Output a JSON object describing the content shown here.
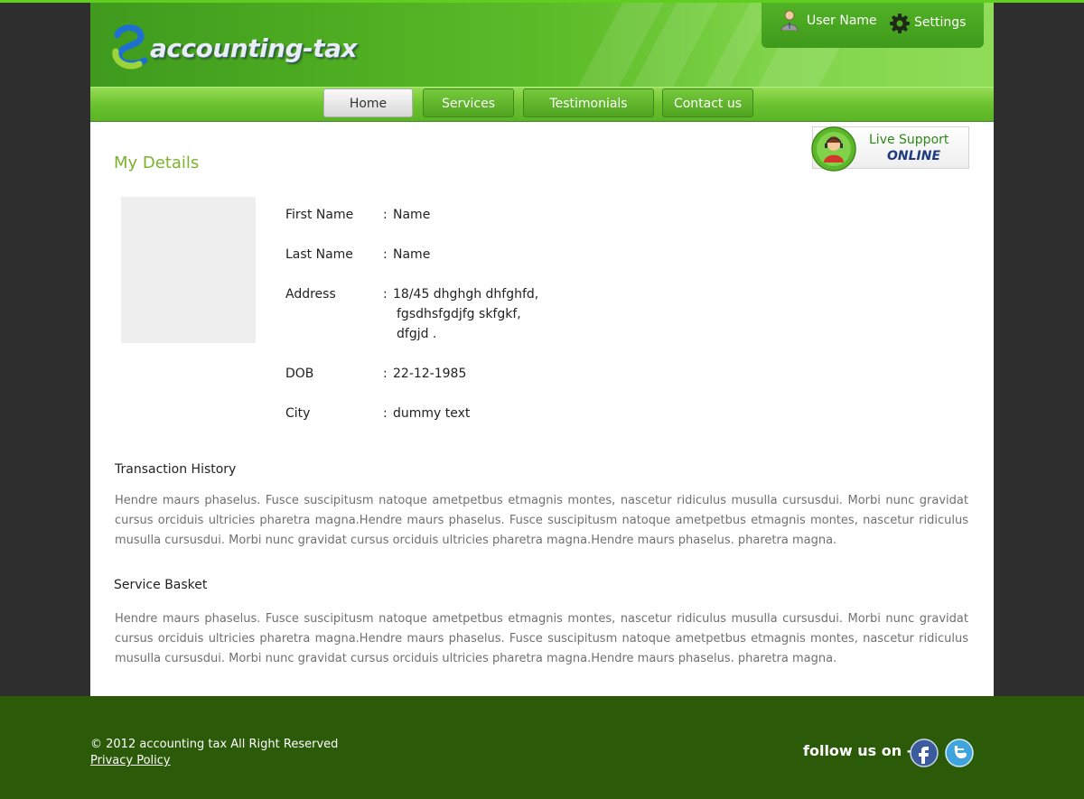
{
  "header": {
    "logo_text": "accounting-tax",
    "user_name": "User Name",
    "settings_label": "Settings"
  },
  "nav": {
    "items": [
      {
        "label": "Home",
        "active": true
      },
      {
        "label": "Services",
        "active": false
      },
      {
        "label": "Testimonials",
        "active": false
      },
      {
        "label": "Contact us",
        "active": false
      }
    ]
  },
  "live_support": {
    "title": "Live Support",
    "status": "ONLINE"
  },
  "details": {
    "title": "My Details",
    "fields": [
      {
        "label": "First Name",
        "values": [
          "Name"
        ]
      },
      {
        "label": "Last Name",
        "values": [
          "Name"
        ]
      },
      {
        "label": "Address",
        "values": [
          "18/45 dhghgh dhfghfd,",
          "fgsdhsfgdjfg skfgkf,",
          "dfgjd ."
        ]
      },
      {
        "label": "DOB",
        "values": [
          "22-12-1985"
        ]
      },
      {
        "label": "City",
        "values": [
          "dummy text"
        ]
      }
    ]
  },
  "transaction_history": {
    "title": "Transaction History",
    "text": "Hendre maurs phaselus. Fusce suscipitusm natoque ametpetbus etmagnis montes, nascetur ridiculus musulla cursusdui. Morbi nunc gravidat cursus orciduis ultricies pharetra magna.Hendre maurs phaselus. Fusce suscipitusm natoque ametpetbus etmagnis montes, nascetur ridiculus musulla cursusdui. Morbi nunc gravidat cursus orciduis ultricies pharetra magna.Hendre maurs phaselus. pharetra magna."
  },
  "service_basket": {
    "title": "Service Basket",
    "text": "Hendre maurs phaselus. Fusce suscipitusm natoque ametpetbus etmagnis montes, nascetur ridiculus musulla cursusdui. Morbi nunc gravidat cursus orciduis ultricies pharetra magna.Hendre maurs phaselus. Fusce suscipitusm natoque ametpetbus etmagnis montes, nascetur ridiculus musulla cursusdui. Morbi nunc gravidat cursus orciduis ultricies pharetra magna.Hendre maurs phaselus. pharetra magna."
  },
  "footer": {
    "copyright": "© 2012 accounting tax All Right Reserved",
    "privacy_label": "Privacy Policy",
    "follow_label": "follow us on -",
    "social": [
      {
        "name": "facebook",
        "icon": "facebook-icon"
      },
      {
        "name": "twitter",
        "icon": "twitter-icon"
      }
    ]
  },
  "colors": {
    "brand_green": "#5fbe2a",
    "title_green": "#7ab32e",
    "footer_green": "#2b5a08",
    "background": "#2e2e2e"
  }
}
